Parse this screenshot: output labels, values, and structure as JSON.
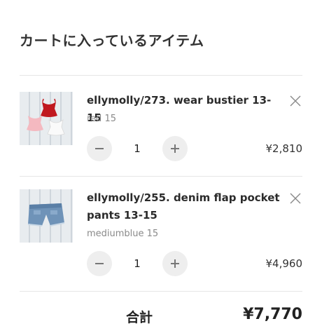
{
  "cart": {
    "title": "カートに入っているアイテム"
  },
  "items": [
    {
      "name": "ellymolly/273. wear bustier 13-15",
      "variant": "red 15",
      "quantity": "1",
      "price": "¥2,810",
      "thumbnail_icon": "bustier-photo",
      "remove_icon": "close-icon",
      "decrement_icon": "minus-icon",
      "increment_icon": "plus-icon"
    },
    {
      "name": "ellymolly/255. denim flap pocket pants 13-15",
      "variant": "mediumblue 15",
      "quantity": "1",
      "price": "¥4,960",
      "thumbnail_icon": "denim-shorts-photo",
      "remove_icon": "close-icon",
      "decrement_icon": "minus-icon",
      "increment_icon": "plus-icon"
    }
  ],
  "summary": {
    "total_label": "合計",
    "total_value": "¥7,770"
  },
  "colors": {
    "text": "#333333",
    "muted": "#8a8a8a",
    "divider": "#e6e6e6",
    "button_bg": "#eeeeee"
  }
}
